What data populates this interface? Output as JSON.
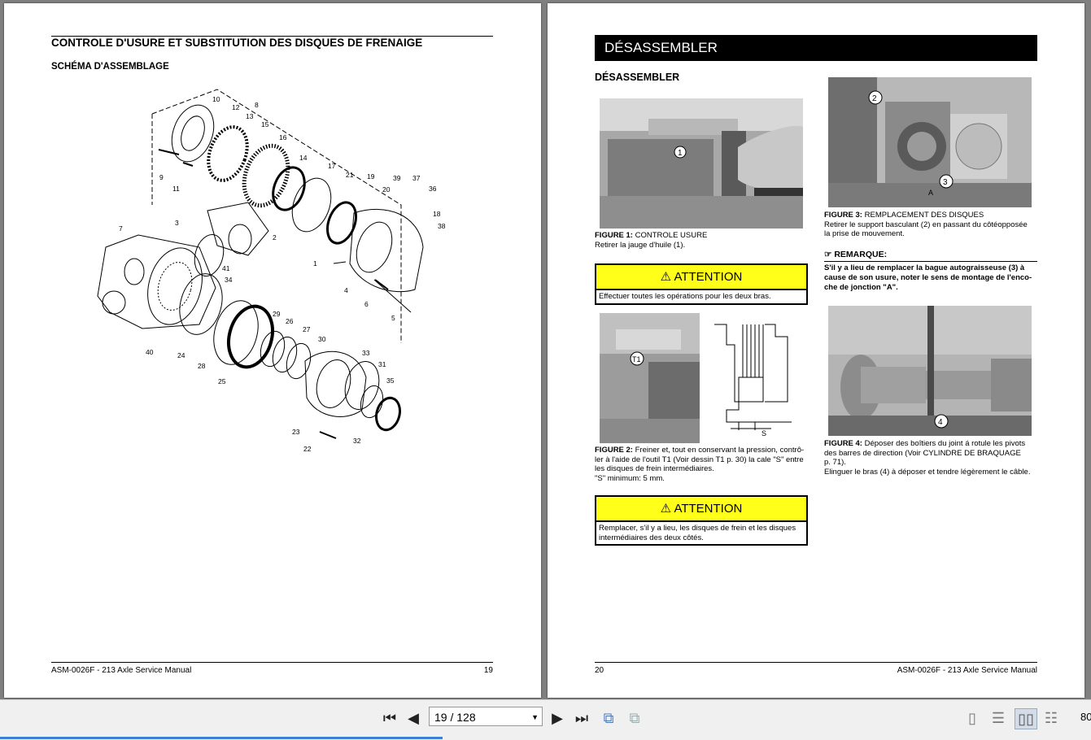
{
  "left_page": {
    "title": "CONTROLE D'USURE ET SUBSTITUTION DES DISQUES DE FRENAIGE",
    "subtitle": "SCHÉMA D'ASSEMBLAGE",
    "diagram_labels": [
      "10",
      "12",
      "13",
      "8",
      "15",
      "16",
      "14",
      "17",
      "21",
      "19",
      "20",
      "39",
      "37",
      "36",
      "18",
      "38",
      "9",
      "11",
      "7",
      "3",
      "2",
      "1",
      "41",
      "34",
      "4",
      "6",
      "5",
      "29",
      "26",
      "27",
      "30",
      "33",
      "31",
      "35",
      "40",
      "24",
      "28",
      "25",
      "23",
      "22",
      "32"
    ],
    "footer_left": "ASM-0026F - 213 Axle Service Manual",
    "footer_right": "19"
  },
  "right_page": {
    "banner": "DÉSASSEMBLER",
    "heading": "DÉSASSEMBLER",
    "fig1": {
      "label": "FIGURE 1:",
      "title": "CONTROLE USURE",
      "text": "Retirer la jauge d'huile (1).",
      "callouts": [
        "1"
      ]
    },
    "attention1": {
      "title": "ATTENTION",
      "text": "Effectuer toutes les opérations pour les deux bras."
    },
    "fig2": {
      "label": "FIGURE 2:",
      "text1": "Freiner et, tout en conservant la pression, contrô-",
      "text2": "ler à l'aide de l'outil T1 (Voir dessin T1 p. 30) la cale \"S\" entre",
      "text3": "les disques de frein intermédiaires.",
      "text4": "\"S\" minimum: 5 mm.",
      "callouts": [
        "T1",
        "S"
      ]
    },
    "attention2": {
      "title": "ATTENTION",
      "text1": "Remplacer, s'il y a lieu, les disques de frein et les disques",
      "text2": "intermédiaires des deux côtés."
    },
    "fig3": {
      "label": "FIGURE 3:",
      "title": "REMPLACEMENT DES DISQUES",
      "text1": "Retirer le support basculant (2) en passant du côtéopposée",
      "text2": "la prise de mouvement.",
      "callouts": [
        "2",
        "3",
        "A"
      ]
    },
    "note": {
      "title": "REMARQUE:",
      "text1": "S'il y a lieu de remplacer la bague autograisseuse (3) à",
      "text2": "cause de son usure, noter le sens de montage de l'enco-",
      "text3": "che de jonction \"A\"."
    },
    "fig4": {
      "label": "FIGURE 4:",
      "text1": "Déposer des boîtiers du joint á rotule les pivots",
      "text2": "des barres de direction (Voir CYLINDRE DE BRAQUAGE",
      "text3": "p. 71).",
      "text4": "Elinguer le bras (4) à déposer et tendre légèrement le câble.",
      "callouts": [
        "4"
      ]
    },
    "footer_left": "20",
    "footer_right": "ASM-0026F - 213 Axle Service Manual"
  },
  "toolbar": {
    "page_value": "19 / 128",
    "zoom": "80",
    "progress": 0.406,
    "icons": [
      "first-page-icon",
      "prev-page-icon",
      "next-page-icon",
      "last-page-icon",
      "fit-page-icon",
      "fit-width-icon",
      "single-page-icon",
      "continuous-icon",
      "two-page-icon",
      "two-page-continuous-icon"
    ]
  }
}
